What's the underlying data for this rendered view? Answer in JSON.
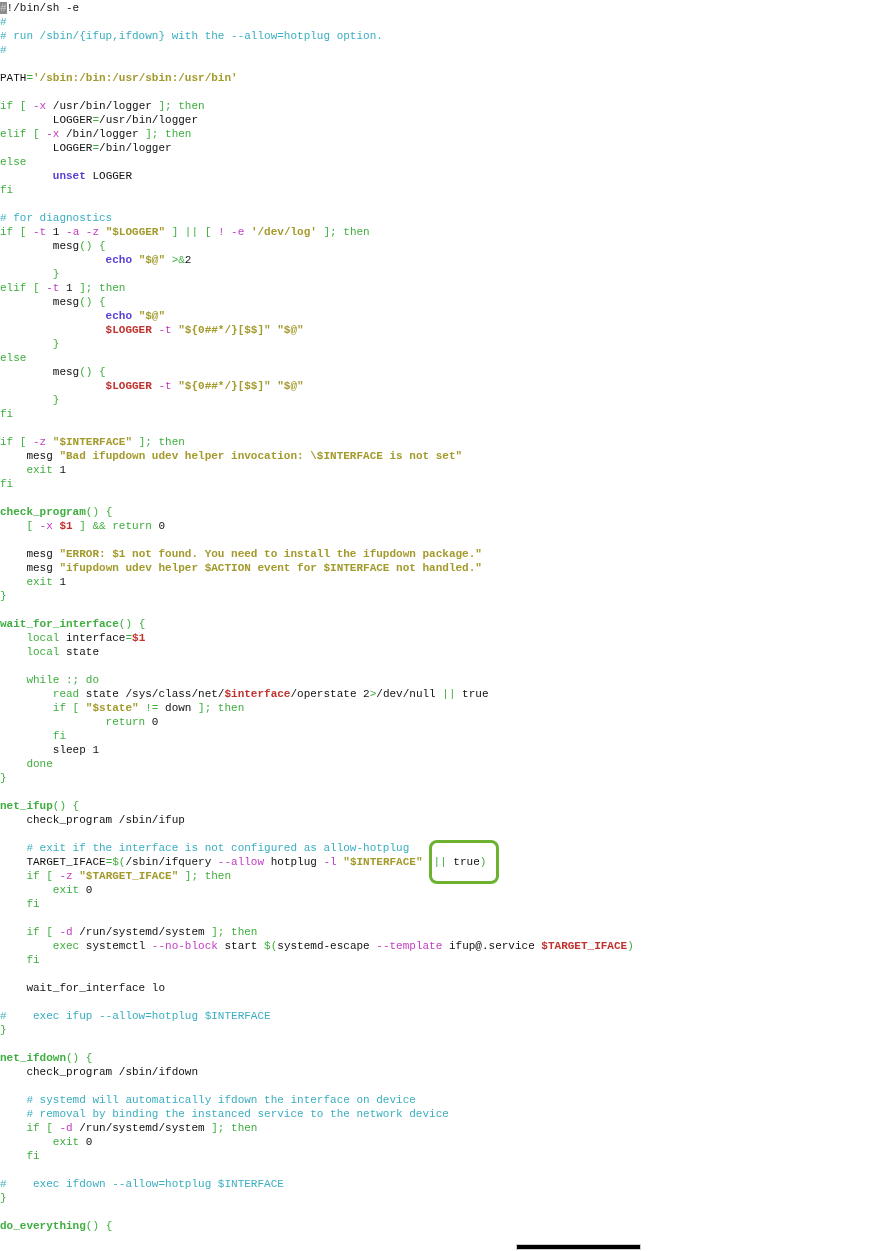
{
  "editor": {
    "lines": [
      {
        "kind": "code",
        "spans": [
          {
            "kind": "cursor",
            "text": "#"
          },
          {
            "kind": "p",
            "text": "!/bin/sh -e"
          }
        ]
      },
      {
        "kind": "code",
        "spans": [
          {
            "kind": "c",
            "text": "#"
          }
        ]
      },
      {
        "kind": "code",
        "spans": [
          {
            "kind": "c",
            "text": "# run /sbin/{ifup,ifdown} with the --allow=hotplug option."
          }
        ]
      },
      {
        "kind": "code",
        "spans": [
          {
            "kind": "c",
            "text": "#"
          }
        ]
      },
      {
        "kind": "blank"
      },
      {
        "kind": "code",
        "spans": [
          {
            "kind": "p",
            "text": "PATH"
          },
          {
            "kind": "k",
            "text": "="
          },
          {
            "kind": "s",
            "text": "'/sbin:/bin:/usr/sbin:/usr/bin'"
          }
        ]
      },
      {
        "kind": "blank"
      },
      {
        "kind": "code",
        "spans": [
          {
            "kind": "k",
            "text": "if [ "
          },
          {
            "kind": "o",
            "text": "-x"
          },
          {
            "kind": "p",
            "text": " /usr/bin/logger "
          },
          {
            "kind": "k",
            "text": "]; then"
          }
        ]
      },
      {
        "kind": "code",
        "spans": [
          {
            "kind": "p",
            "text": "        LOGGER"
          },
          {
            "kind": "k",
            "text": "="
          },
          {
            "kind": "p",
            "text": "/usr/bin/logger"
          }
        ]
      },
      {
        "kind": "code",
        "spans": [
          {
            "kind": "k",
            "text": "elif [ "
          },
          {
            "kind": "o",
            "text": "-x"
          },
          {
            "kind": "p",
            "text": " /bin/logger "
          },
          {
            "kind": "k",
            "text": "]; then"
          }
        ]
      },
      {
        "kind": "code",
        "spans": [
          {
            "kind": "p",
            "text": "        LOGGER"
          },
          {
            "kind": "k",
            "text": "="
          },
          {
            "kind": "p",
            "text": "/bin/logger"
          }
        ]
      },
      {
        "kind": "code",
        "spans": [
          {
            "kind": "k",
            "text": "else"
          }
        ]
      },
      {
        "kind": "code",
        "spans": [
          {
            "kind": "b",
            "text": "        unset"
          },
          {
            "kind": "p",
            "text": " LOGGER"
          }
        ]
      },
      {
        "kind": "code",
        "spans": [
          {
            "kind": "k",
            "text": "fi"
          }
        ]
      },
      {
        "kind": "blank"
      },
      {
        "kind": "code",
        "spans": [
          {
            "kind": "c",
            "text": "# for diagnostics"
          }
        ]
      },
      {
        "kind": "code",
        "spans": [
          {
            "kind": "k",
            "text": "if [ "
          },
          {
            "kind": "o",
            "text": "-t"
          },
          {
            "kind": "p",
            "text": " 1 "
          },
          {
            "kind": "o",
            "text": "-a -z"
          },
          {
            "kind": "s",
            "text": " \"$LOGGER\""
          },
          {
            "kind": "k",
            "text": " ] || [ "
          },
          {
            "kind": "o",
            "text": "! -e"
          },
          {
            "kind": "s",
            "text": " '/dev/log'"
          },
          {
            "kind": "k",
            "text": " ]; then"
          }
        ]
      },
      {
        "kind": "code",
        "spans": [
          {
            "kind": "p",
            "text": "        mesg"
          },
          {
            "kind": "k",
            "text": "() {"
          }
        ]
      },
      {
        "kind": "code",
        "spans": [
          {
            "kind": "b",
            "text": "                echo"
          },
          {
            "kind": "s",
            "text": " \"$@\""
          },
          {
            "kind": "k",
            "text": " >&"
          },
          {
            "kind": "p",
            "text": "2"
          }
        ]
      },
      {
        "kind": "code",
        "spans": [
          {
            "kind": "k",
            "text": "        }"
          }
        ]
      },
      {
        "kind": "code",
        "spans": [
          {
            "kind": "k",
            "text": "elif [ "
          },
          {
            "kind": "o",
            "text": "-t"
          },
          {
            "kind": "p",
            "text": " 1 "
          },
          {
            "kind": "k",
            "text": "]; then"
          }
        ]
      },
      {
        "kind": "code",
        "spans": [
          {
            "kind": "p",
            "text": "        mesg"
          },
          {
            "kind": "k",
            "text": "() {"
          }
        ]
      },
      {
        "kind": "code",
        "spans": [
          {
            "kind": "b",
            "text": "                echo"
          },
          {
            "kind": "s",
            "text": " \"$@\""
          }
        ]
      },
      {
        "kind": "code",
        "spans": [
          {
            "kind": "v",
            "text": "                $LOGGER"
          },
          {
            "kind": "o",
            "text": " -t"
          },
          {
            "kind": "s",
            "text": " \"${0##*/}[$$]\" \"$@\""
          }
        ]
      },
      {
        "kind": "code",
        "spans": [
          {
            "kind": "k",
            "text": "        }"
          }
        ]
      },
      {
        "kind": "code",
        "spans": [
          {
            "kind": "k",
            "text": "else"
          }
        ]
      },
      {
        "kind": "code",
        "spans": [
          {
            "kind": "p",
            "text": "        mesg"
          },
          {
            "kind": "k",
            "text": "() {"
          }
        ]
      },
      {
        "kind": "code",
        "spans": [
          {
            "kind": "v",
            "text": "                $LOGGER"
          },
          {
            "kind": "o",
            "text": " -t"
          },
          {
            "kind": "s",
            "text": " \"${0##*/}[$$]\" \"$@\""
          }
        ]
      },
      {
        "kind": "code",
        "spans": [
          {
            "kind": "k",
            "text": "        }"
          }
        ]
      },
      {
        "kind": "code",
        "spans": [
          {
            "kind": "k",
            "text": "fi"
          }
        ]
      },
      {
        "kind": "blank"
      },
      {
        "kind": "code",
        "spans": [
          {
            "kind": "k",
            "text": "if [ "
          },
          {
            "kind": "o",
            "text": "-z"
          },
          {
            "kind": "s",
            "text": " \"$INTERFACE\""
          },
          {
            "kind": "k",
            "text": " ]; then"
          }
        ]
      },
      {
        "kind": "code",
        "spans": [
          {
            "kind": "p",
            "text": "    mesg "
          },
          {
            "kind": "s",
            "text": "\"Bad ifupdown udev helper invocation: \\$INTERFACE is not set\""
          }
        ]
      },
      {
        "kind": "code",
        "spans": [
          {
            "kind": "k",
            "text": "    exit"
          },
          {
            "kind": "p",
            "text": " 1"
          }
        ]
      },
      {
        "kind": "code",
        "spans": [
          {
            "kind": "k",
            "text": "fi"
          }
        ]
      },
      {
        "kind": "blank"
      },
      {
        "kind": "code",
        "spans": [
          {
            "kind": "f",
            "text": "check_program"
          },
          {
            "kind": "k",
            "text": "() {"
          }
        ]
      },
      {
        "kind": "code",
        "spans": [
          {
            "kind": "k",
            "text": "    [ "
          },
          {
            "kind": "o",
            "text": "-x"
          },
          {
            "kind": "v",
            "text": " $1"
          },
          {
            "kind": "k",
            "text": " ] && return"
          },
          {
            "kind": "p",
            "text": " 0"
          }
        ]
      },
      {
        "kind": "blank"
      },
      {
        "kind": "code",
        "spans": [
          {
            "kind": "p",
            "text": "    mesg "
          },
          {
            "kind": "s",
            "text": "\"ERROR: $1 not found. You need to install the ifupdown package.\""
          }
        ]
      },
      {
        "kind": "code",
        "spans": [
          {
            "kind": "p",
            "text": "    mesg "
          },
          {
            "kind": "s",
            "text": "\"ifupdown udev helper $ACTION event for $INTERFACE not handled.\""
          }
        ]
      },
      {
        "kind": "code",
        "spans": [
          {
            "kind": "k",
            "text": "    exit"
          },
          {
            "kind": "p",
            "text": " 1"
          }
        ]
      },
      {
        "kind": "code",
        "spans": [
          {
            "kind": "k",
            "text": "}"
          }
        ]
      },
      {
        "kind": "blank"
      },
      {
        "kind": "code",
        "spans": [
          {
            "kind": "f",
            "text": "wait_for_interface"
          },
          {
            "kind": "k",
            "text": "() {"
          }
        ]
      },
      {
        "kind": "code",
        "spans": [
          {
            "kind": "k",
            "text": "    local"
          },
          {
            "kind": "p",
            "text": " interface"
          },
          {
            "kind": "k",
            "text": "="
          },
          {
            "kind": "v",
            "text": "$1"
          }
        ]
      },
      {
        "kind": "code",
        "spans": [
          {
            "kind": "k",
            "text": "    local"
          },
          {
            "kind": "p",
            "text": " state"
          }
        ]
      },
      {
        "kind": "blank"
      },
      {
        "kind": "code",
        "spans": [
          {
            "kind": "k",
            "text": "    while :; do"
          }
        ]
      },
      {
        "kind": "code",
        "spans": [
          {
            "kind": "k",
            "text": "        read"
          },
          {
            "kind": "p",
            "text": " state /sys/class/net/"
          },
          {
            "kind": "v",
            "text": "$interface"
          },
          {
            "kind": "p",
            "text": "/operstate 2"
          },
          {
            "kind": "k",
            "text": ">"
          },
          {
            "kind": "p",
            "text": "/dev/null "
          },
          {
            "kind": "k",
            "text": "||"
          },
          {
            "kind": "p",
            "text": " true"
          }
        ]
      },
      {
        "kind": "code",
        "spans": [
          {
            "kind": "k",
            "text": "        if [ "
          },
          {
            "kind": "s",
            "text": "\"$state\""
          },
          {
            "kind": "k",
            "text": " != "
          },
          {
            "kind": "p",
            "text": "down "
          },
          {
            "kind": "k",
            "text": "]; then"
          }
        ]
      },
      {
        "kind": "code",
        "spans": [
          {
            "kind": "k",
            "text": "                return"
          },
          {
            "kind": "p",
            "text": " 0"
          }
        ]
      },
      {
        "kind": "code",
        "spans": [
          {
            "kind": "k",
            "text": "        fi"
          }
        ]
      },
      {
        "kind": "code",
        "spans": [
          {
            "kind": "p",
            "text": "        sleep 1"
          }
        ]
      },
      {
        "kind": "code",
        "spans": [
          {
            "kind": "k",
            "text": "    done"
          }
        ]
      },
      {
        "kind": "code",
        "spans": [
          {
            "kind": "k",
            "text": "}"
          }
        ]
      },
      {
        "kind": "blank"
      },
      {
        "kind": "code",
        "spans": [
          {
            "kind": "f",
            "text": "net_ifup"
          },
          {
            "kind": "k",
            "text": "() {"
          }
        ]
      },
      {
        "kind": "code",
        "spans": [
          {
            "kind": "p",
            "text": "    check_program /sbin/ifup"
          }
        ]
      },
      {
        "kind": "blank"
      },
      {
        "kind": "code",
        "spans": [
          {
            "kind": "c",
            "text": "    # exit if the interface is not configured as allow-hotplug"
          }
        ]
      },
      {
        "kind": "code",
        "spans": [
          {
            "kind": "p",
            "text": "    TARGET_IFACE"
          },
          {
            "kind": "k",
            "text": "=$("
          },
          {
            "kind": "p",
            "text": "/sbin/ifquery "
          },
          {
            "kind": "o",
            "text": "--allow"
          },
          {
            "kind": "p",
            "text": " hotplug "
          },
          {
            "kind": "o",
            "text": "-l"
          },
          {
            "kind": "s",
            "text": " \"$INTERFACE\""
          },
          {
            "kind": "highlight",
            "spans": [
              {
                "kind": "k",
                "text": "||"
              },
              {
                "kind": "p",
                "text": " true"
              },
              {
                "kind": "k",
                "text": ")"
              }
            ]
          }
        ]
      },
      {
        "kind": "code",
        "spans": [
          {
            "kind": "k",
            "text": "    if [ "
          },
          {
            "kind": "o",
            "text": "-z"
          },
          {
            "kind": "s",
            "text": " \"$TARGET_IFACE\""
          },
          {
            "kind": "k",
            "text": " ]; then"
          }
        ]
      },
      {
        "kind": "code",
        "spans": [
          {
            "kind": "k",
            "text": "        exit"
          },
          {
            "kind": "p",
            "text": " 0"
          }
        ]
      },
      {
        "kind": "code",
        "spans": [
          {
            "kind": "k",
            "text": "    fi"
          }
        ]
      },
      {
        "kind": "blank"
      },
      {
        "kind": "code",
        "spans": [
          {
            "kind": "k",
            "text": "    if [ "
          },
          {
            "kind": "o",
            "text": "-d"
          },
          {
            "kind": "p",
            "text": " /run/systemd/system "
          },
          {
            "kind": "k",
            "text": "]; then"
          }
        ]
      },
      {
        "kind": "code",
        "spans": [
          {
            "kind": "k",
            "text": "        exec"
          },
          {
            "kind": "p",
            "text": " systemctl "
          },
          {
            "kind": "o",
            "text": "--no-block"
          },
          {
            "kind": "p",
            "text": " start "
          },
          {
            "kind": "k",
            "text": "$("
          },
          {
            "kind": "p",
            "text": "systemd-escape "
          },
          {
            "kind": "o",
            "text": "--template"
          },
          {
            "kind": "p",
            "text": " ifup@.service "
          },
          {
            "kind": "v",
            "text": "$TARGET_IFACE"
          },
          {
            "kind": "k",
            "text": ")"
          }
        ]
      },
      {
        "kind": "code",
        "spans": [
          {
            "kind": "k",
            "text": "    fi"
          }
        ]
      },
      {
        "kind": "blank"
      },
      {
        "kind": "code",
        "spans": [
          {
            "kind": "p",
            "text": "    wait_for_interface lo"
          }
        ]
      },
      {
        "kind": "blank"
      },
      {
        "kind": "code",
        "spans": [
          {
            "kind": "c",
            "text": "#    exec ifup --allow=hotplug $INTERFACE"
          }
        ]
      },
      {
        "kind": "code",
        "spans": [
          {
            "kind": "k",
            "text": "}"
          }
        ]
      },
      {
        "kind": "blank"
      },
      {
        "kind": "code",
        "spans": [
          {
            "kind": "f",
            "text": "net_ifdown"
          },
          {
            "kind": "k",
            "text": "() {"
          }
        ]
      },
      {
        "kind": "code",
        "spans": [
          {
            "kind": "p",
            "text": "    check_program /sbin/ifdown"
          }
        ]
      },
      {
        "kind": "blank"
      },
      {
        "kind": "code",
        "spans": [
          {
            "kind": "c",
            "text": "    # systemd will automatically ifdown the interface on device"
          }
        ]
      },
      {
        "kind": "code",
        "spans": [
          {
            "kind": "c",
            "text": "    # removal by binding the instanced service to the network device"
          }
        ]
      },
      {
        "kind": "code",
        "spans": [
          {
            "kind": "k",
            "text": "    if [ "
          },
          {
            "kind": "o",
            "text": "-d"
          },
          {
            "kind": "p",
            "text": " /run/systemd/system "
          },
          {
            "kind": "k",
            "text": "]; then"
          }
        ]
      },
      {
        "kind": "code",
        "spans": [
          {
            "kind": "k",
            "text": "        exit"
          },
          {
            "kind": "p",
            "text": " 0"
          }
        ]
      },
      {
        "kind": "code",
        "spans": [
          {
            "kind": "k",
            "text": "    fi"
          }
        ]
      },
      {
        "kind": "blank"
      },
      {
        "kind": "code",
        "spans": [
          {
            "kind": "c",
            "text": "#    exec ifdown --allow=hotplug $INTERFACE"
          }
        ]
      },
      {
        "kind": "code",
        "spans": [
          {
            "kind": "k",
            "text": "}"
          }
        ]
      },
      {
        "kind": "blank"
      },
      {
        "kind": "code",
        "spans": [
          {
            "kind": "f",
            "text": "do_everything"
          },
          {
            "kind": "k",
            "text": "() {"
          }
        ]
      }
    ]
  },
  "status_bar": {
    "kind": "bar"
  }
}
